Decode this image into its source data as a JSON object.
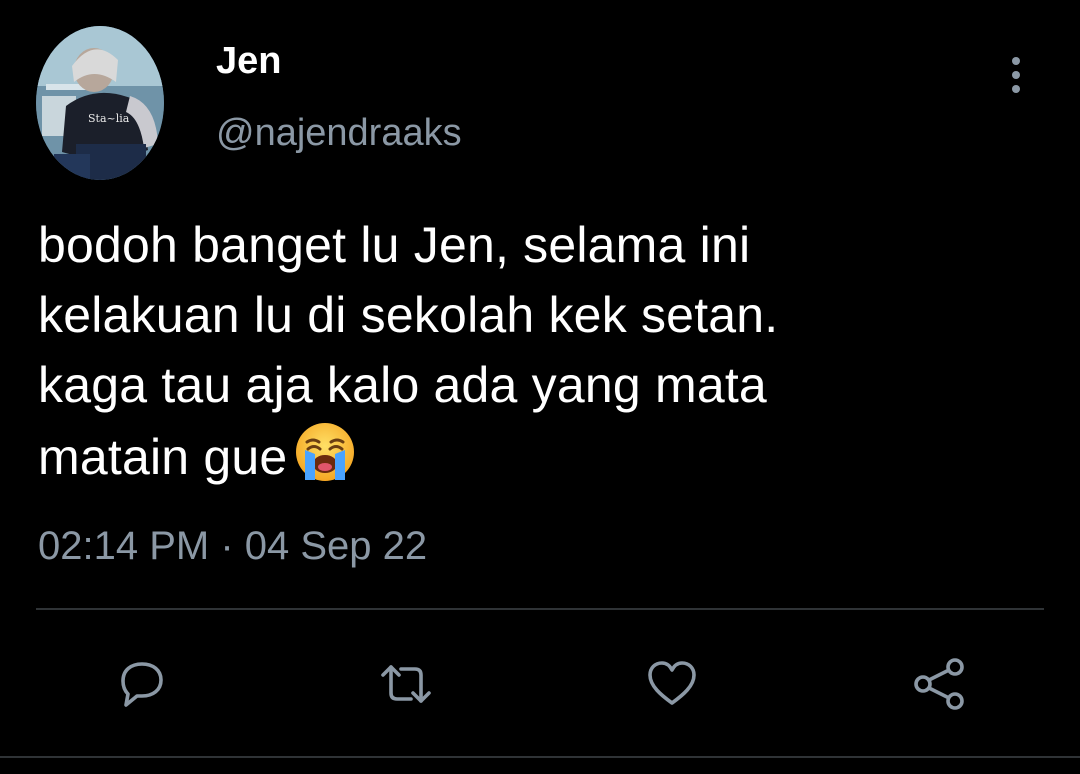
{
  "tweet": {
    "author": {
      "display_name": "Jen",
      "handle": "@najendraaks",
      "avatar_icon": "avatar-photo"
    },
    "text_lines": [
      "bodoh banget lu Jen, selama ini",
      "kelakuan lu di sekolah kek setan.",
      "kaga tau aja kalo ada yang mata",
      "matain gue"
    ],
    "emoji": "loudly-crying-face",
    "timestamp": "02:14 PM · 04 Sep 22",
    "actions": [
      {
        "name": "reply",
        "icon": "speech-bubble-icon"
      },
      {
        "name": "retweet",
        "icon": "retweet-icon"
      },
      {
        "name": "like",
        "icon": "heart-icon"
      },
      {
        "name": "share",
        "icon": "share-icon"
      }
    ]
  },
  "colors": {
    "background": "#000000",
    "primary_text": "#ffffff",
    "secondary_text": "#8b98a5",
    "divider": "#2f3336",
    "icon": "#8b98a5"
  }
}
